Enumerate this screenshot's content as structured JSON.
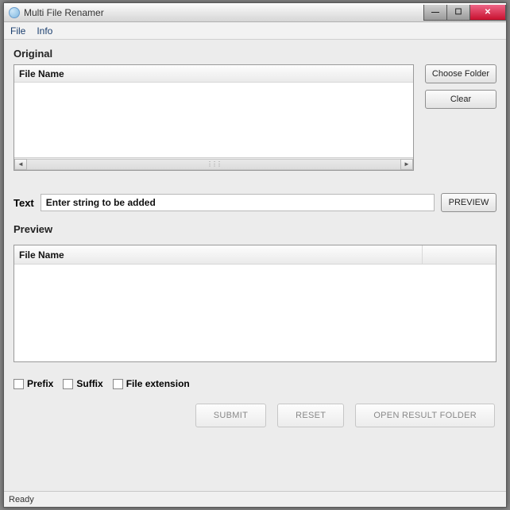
{
  "title": "Multi File Renamer",
  "menu": {
    "file": "File",
    "info": "Info"
  },
  "original": {
    "label": "Original",
    "column": "File Name",
    "choose": "Choose Folder",
    "clear": "Clear"
  },
  "text": {
    "label": "Text",
    "value": "Enter string to be added",
    "preview_btn": "PREVIEW"
  },
  "preview": {
    "label": "Preview",
    "column": "File Name"
  },
  "checks": {
    "prefix": "Prefix",
    "suffix": "Suffix",
    "ext": "File extension"
  },
  "buttons": {
    "submit": "SUBMIT",
    "reset": "RESET",
    "open_result": "OPEN RESULT FOLDER"
  },
  "status": "Ready"
}
